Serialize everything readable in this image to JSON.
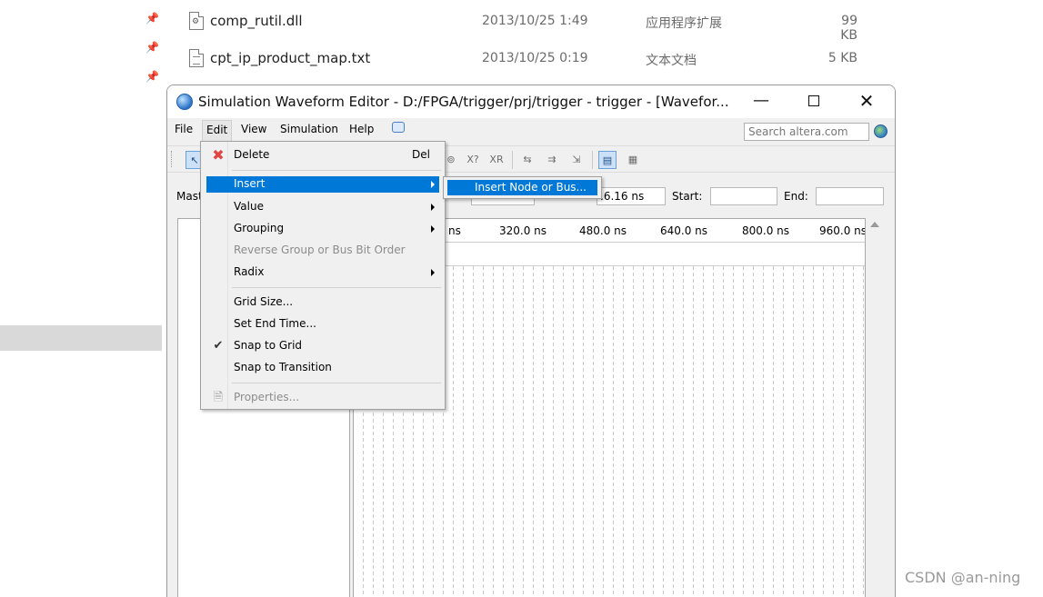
{
  "explorer": {
    "files": [
      {
        "name": "comp_rutil.dll",
        "date": "2013/10/25 1:49",
        "type": "应用程序扩展",
        "size": "99 KB",
        "icon": "dll-file-icon"
      },
      {
        "name": "cpt_ip_product_map.txt",
        "date": "2013/10/25 0:19",
        "type": "文本文档",
        "size": "5 KB",
        "icon": "text-file-icon"
      }
    ],
    "pin_glyph": "📌"
  },
  "window": {
    "title": "Simulation Waveform Editor - D:/FPGA/trigger/prj/trigger - trigger - [Wavefor...",
    "min_glyph": "—",
    "close_glyph": "✕"
  },
  "menubar": {
    "items": [
      "File",
      "Edit",
      "View",
      "Simulation",
      "Help"
    ],
    "search_placeholder": "Search altera.com"
  },
  "toolbar": {
    "buttons": [
      "↖",
      "⊚",
      "X?",
      "XR",
      "⇆",
      "⇉",
      "⇲",
      "▤",
      "▦"
    ]
  },
  "info": {
    "master_label": "Mast",
    "time_value": ".6.16 ns",
    "start_label": "Start:",
    "start_value": "",
    "end_label": "End:",
    "end_value": ""
  },
  "timeline": {
    "ticks": [
      "ns",
      "320.0 ns",
      "480.0 ns",
      "640.0 ns",
      "800.0 ns",
      "960.0 ns"
    ]
  },
  "edit_menu": {
    "items": [
      {
        "label": "Delete",
        "shortcut": "Del",
        "icon": "delete-x-icon"
      },
      {
        "label": "Insert",
        "submenu": true,
        "highlighted": true
      },
      {
        "label": "Value",
        "submenu": true
      },
      {
        "label": "Grouping",
        "submenu": true
      },
      {
        "label": "Reverse Group or Bus Bit Order",
        "disabled": true
      },
      {
        "label": "Radix",
        "submenu": true
      },
      {
        "label": "Grid Size..."
      },
      {
        "label": "Set End Time..."
      },
      {
        "label": "Snap to Grid",
        "checked": true
      },
      {
        "label": "Snap to Transition"
      },
      {
        "label": "Properties...",
        "disabled": true,
        "icon": "properties-icon"
      }
    ],
    "icons": {
      "delete": "✖",
      "check": "✔",
      "properties": "🗎"
    }
  },
  "insert_submenu": {
    "items": [
      {
        "label": "Insert Node or Bus...",
        "highlighted": true
      }
    ]
  },
  "watermark": "CSDN @an-ning",
  "colors": {
    "menu_highlight": "#0078d7",
    "delete_red": "#e04545"
  }
}
